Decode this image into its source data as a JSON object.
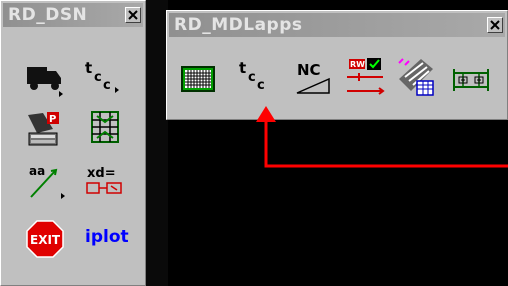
{
  "left_window": {
    "title": "RD_DSN",
    "tools": [
      {
        "icon": "truck-icon"
      },
      {
        "icon": "tcc-icon",
        "label": "tcc"
      },
      {
        "icon": "design-edit-icon"
      },
      {
        "icon": "grid-frame-icon"
      },
      {
        "icon": "aa-line-icon",
        "label": "aa"
      },
      {
        "icon": "xd-table-icon",
        "label": "xd="
      },
      {
        "icon": "exit-icon",
        "label": "EXIT"
      },
      {
        "icon": "iplot-icon",
        "label": "iplot"
      }
    ]
  },
  "right_window": {
    "title": "RD_MDLapps",
    "tools": [
      {
        "icon": "green-grid-icon"
      },
      {
        "icon": "tcc-icon",
        "label": "tcc"
      },
      {
        "icon": "nc-triangle-icon",
        "label": "NC"
      },
      {
        "icon": "rw-level-icon",
        "label": "RW"
      },
      {
        "icon": "stripe-table-icon"
      },
      {
        "icon": "beam-icon"
      }
    ]
  },
  "annotation": {
    "color": "#ff0000"
  },
  "colors": {
    "panel": "#c0c0c0",
    "title_bar": "#9a9a9a",
    "title_text": "#e4e4e4",
    "background": "#000000",
    "iplot_blue": "#0000ff",
    "exit_red": "#e00000"
  }
}
